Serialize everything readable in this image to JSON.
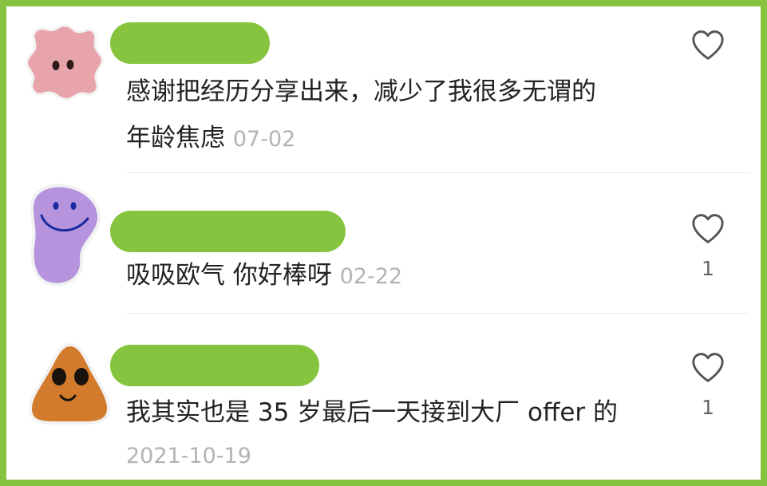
{
  "comments": [
    {
      "text_line1": "感谢把经历分享出来，减少了我很多无谓的",
      "text_line2": "年龄焦虑",
      "date": "07-02",
      "like_count": "",
      "avatar_icon": "pink-flower-face-icon",
      "avatar_color": "#e8a4ab"
    },
    {
      "text": "吸吸欧气 你好棒呀",
      "date": "02-22",
      "like_count": "1",
      "avatar_icon": "purple-smiley-icon",
      "avatar_color": "#b594dd"
    },
    {
      "text": "我其实也是 35 岁最后一天接到大厂 offer 的",
      "date": "2021-10-19",
      "like_count": "1",
      "avatar_icon": "orange-triangle-face-icon",
      "avatar_color": "#d27b2c"
    }
  ],
  "colors": {
    "frame": "#86c43f",
    "redaction": "#86c43f",
    "date": "#b3b3b3",
    "text": "#222222"
  }
}
